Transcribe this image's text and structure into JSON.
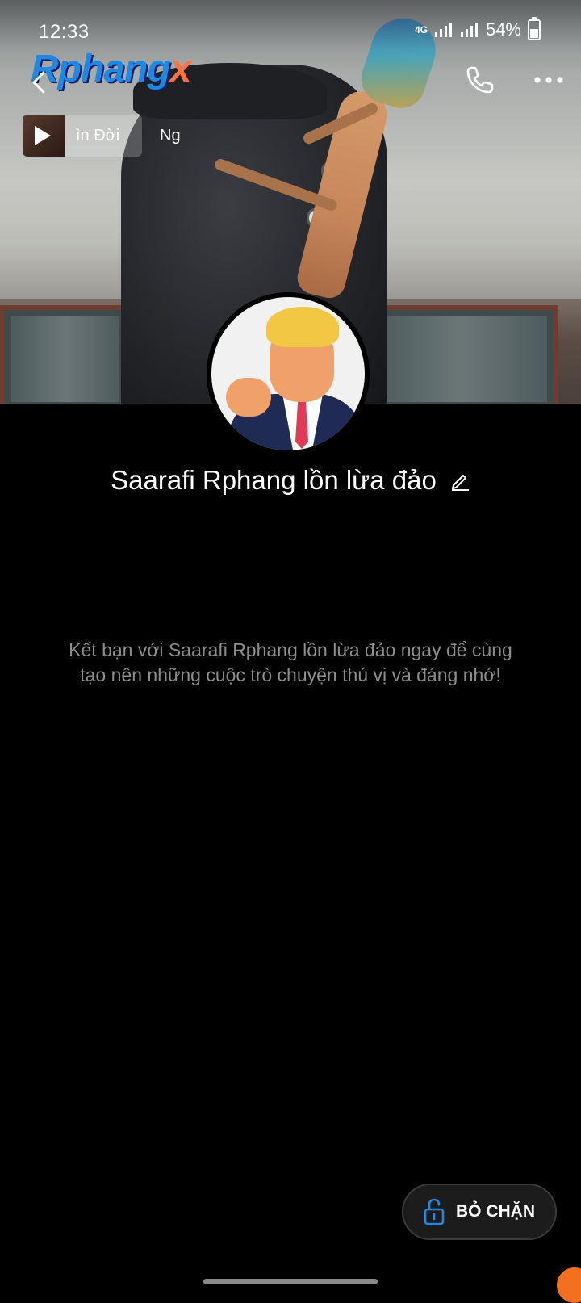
{
  "status_bar": {
    "time": "12:33",
    "network_label": "4G",
    "battery_percent": "54%"
  },
  "header": {
    "watermark_main": "Rphang",
    "watermark_suffix": "x",
    "icons": [
      "back-arrow-icon",
      "phone-icon",
      "more-options-icon"
    ]
  },
  "music": {
    "now_playing": "ìn Đời",
    "next_item": "Ng"
  },
  "profile": {
    "name": "Saarafi Rphang lồn lừa đảo",
    "invite_message": "Kết bạn với Saarafi Rphang lồn lừa đảo ngay để cùng tạo nên những cuộc trò chuyện thú vị và đáng nhớ!"
  },
  "actions": {
    "unblock_label": "BỎ CHẶN"
  },
  "colors": {
    "background": "#000000",
    "accent_blue": "#1e88e5",
    "muted_text": "#8d8d8d",
    "unblock_bg": "#1c1c1c"
  }
}
